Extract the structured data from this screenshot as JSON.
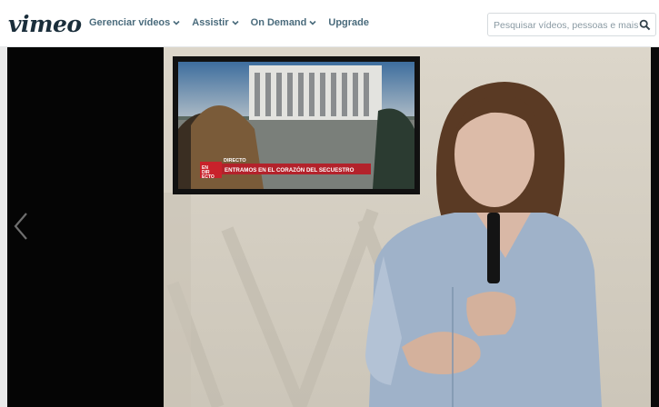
{
  "header": {
    "logo": "vimeo",
    "nav": [
      {
        "label": "Gerenciar vídeos",
        "has_dropdown": true
      },
      {
        "label": "Assistir",
        "has_dropdown": true
      },
      {
        "label": "On Demand",
        "has_dropdown": true
      },
      {
        "label": "Upgrade",
        "has_dropdown": false
      }
    ],
    "search": {
      "placeholder": "Pesquisar vídeos, pessoas e mais",
      "icon": "search-icon"
    }
  },
  "player": {
    "prev_icon": "chevron-left-icon",
    "inset_tv": {
      "badge_lines": [
        "EN",
        "DIR",
        "ECTO"
      ],
      "tag": "DIRECTO",
      "headline": "ENTRAMOS EN EL CORAZÓN DEL SECUESTRO"
    }
  },
  "colors": {
    "logo": "#1a2e3b",
    "nav_text": "#4a6b7c",
    "wall": "#d6d0c4",
    "shirt": "#9fb2c9",
    "ticker_red": "#b3222b"
  }
}
